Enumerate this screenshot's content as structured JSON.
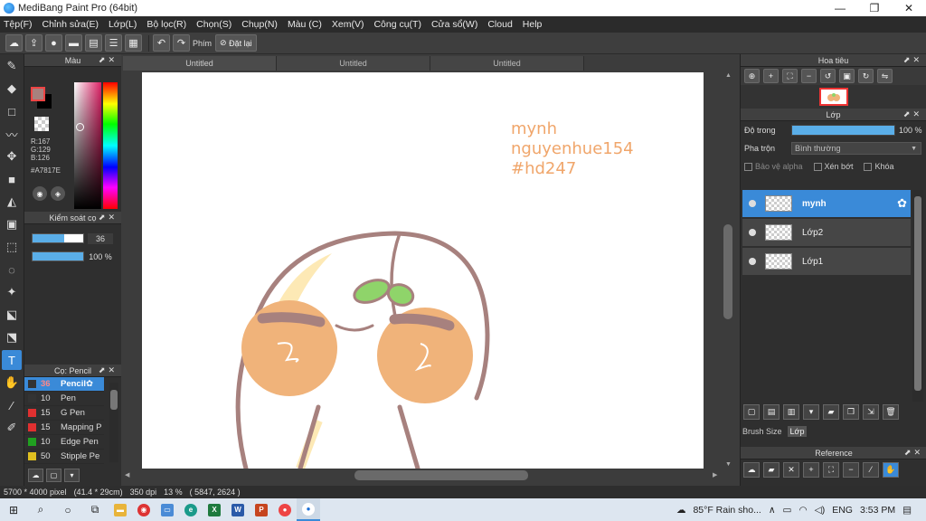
{
  "window": {
    "title": "MediBang Paint Pro (64bit)",
    "minimize": "—",
    "maximize": "❐",
    "close": "✕"
  },
  "menu": [
    "Tệp(F)",
    "Chỉnh sửa(E)",
    "Lớp(L)",
    "Bộ lọc(R)",
    "Chọn(S)",
    "Chụp(N)",
    "Màu (C)",
    "Xem(V)",
    "Công cụ(T)",
    "Cửa sổ(W)",
    "Cloud",
    "Help"
  ],
  "toolbar": {
    "shortcut_label": "Phím",
    "reset_label": "Đặt lại",
    "icons": [
      "cloud-icon",
      "upload-icon",
      "chat-icon",
      "comment-icon",
      "document-icon",
      "list-icon",
      "grid-icon"
    ]
  },
  "tools": [
    "pencil-icon",
    "eraser-icon",
    "rectangle-icon",
    "pen-icon",
    "move-icon",
    "fill-rect-icon",
    "bucket-icon",
    "gradient-icon",
    "select-rect-icon",
    "lasso-icon",
    "magic-wand-icon",
    "select-pen-icon",
    "select-eraser-icon",
    "text-icon",
    "hand-icon",
    "eyedropper-icon",
    "brush-icon"
  ],
  "color_panel": {
    "title": "Màu",
    "r": "R:167",
    "g": "G:129",
    "b": "B:126",
    "hex": "#A7817E",
    "main_color": "#A7817E"
  },
  "brush_control": {
    "title": "Kiểm soát cọ",
    "size_value": "36",
    "size_fraction": 0.62,
    "opacity_value": "100 %",
    "opacity_fraction": 1.0
  },
  "brush_panel": {
    "title": "Cọ: Pencil",
    "items": [
      {
        "size": "36",
        "name": "Pencil",
        "color": "#333333",
        "selected": true
      },
      {
        "size": "10",
        "name": "Pen",
        "color": "#333333",
        "selected": false
      },
      {
        "size": "15",
        "name": "G Pen",
        "color": "#e03030",
        "selected": false
      },
      {
        "size": "15",
        "name": "Mapping P",
        "color": "#e03030",
        "selected": false
      },
      {
        "size": "10",
        "name": "Edge Pen",
        "color": "#20a020",
        "selected": false
      },
      {
        "size": "50",
        "name": "Stipple Pe",
        "color": "#e0c020",
        "selected": false
      }
    ]
  },
  "canvas": {
    "tabs": [
      "Untitled",
      "Untitled",
      "Untitled"
    ],
    "watermark": [
      "mynh",
      "nguyenhue154",
      "#hd247"
    ]
  },
  "status": {
    "size": "5700 * 4000 pixel",
    "physical": "(41.4 * 29cm)",
    "dpi": "350 dpi",
    "zoom": "13 %",
    "coords": "( 5847, 2624 )"
  },
  "navigator": {
    "title": "Hoa tiêu"
  },
  "layer_panel": {
    "title": "Lớp",
    "opacity_label": "Độ trong",
    "opacity_value": "100 %",
    "blend_label": "Pha trộn",
    "blend_value": "Bình thường",
    "protect_alpha": "Bảo vệ alpha",
    "clipping": "Xén bớt",
    "lock": "Khóa",
    "layers": [
      {
        "name": "mynh",
        "selected": true
      },
      {
        "name": "Lớp2",
        "selected": false
      },
      {
        "name": "Lớp1",
        "selected": false
      }
    ],
    "tab_brush_size": "Brush Size",
    "tab_layer": "Lớp"
  },
  "reference_panel": {
    "title": "Reference"
  },
  "taskbar": {
    "weather": "85°F Rain sho...",
    "lang": "ENG",
    "time": "3:53 PM"
  }
}
